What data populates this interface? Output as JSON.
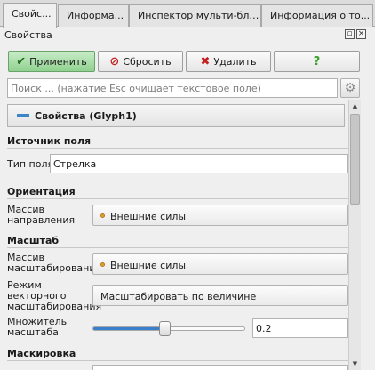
{
  "tabs": [
    {
      "label": "Свойс...",
      "active": true
    },
    {
      "label": "Информа..."
    },
    {
      "label": "Инспектор мульти-бло..."
    },
    {
      "label": "Информация о то..."
    }
  ],
  "panel": {
    "title": "Свойства",
    "float_icon": "float-icon",
    "close_icon": "close-icon"
  },
  "actions": {
    "apply": "Применить",
    "reset": "Сбросить",
    "delete": "Удалить",
    "help": "?"
  },
  "search": {
    "placeholder": "Поиск ... (нажатие Esc очищает текстовое поле)"
  },
  "group": {
    "title": "Свойства (Glyph1)"
  },
  "sections": {
    "field_source": {
      "title": "Источник поля",
      "field_type_label": "Тип поля",
      "field_type_value": "Стрелка"
    },
    "orientation": {
      "title": "Ориентация",
      "label": "Массив направления",
      "value": "Внешние силы"
    },
    "scale": {
      "title": "Масштаб",
      "array_label": "Массив масштабирования",
      "array_value": "Внешние силы",
      "mode_label": "Режим векторного масштабирования",
      "mode_value": "Масштабировать по величине",
      "factor_label": "Множитель масштаба",
      "factor_value": "0.2",
      "factor_fraction": 0.47
    },
    "masking": {
      "title": "Маскировка"
    }
  },
  "colors": {
    "apply_green": "#8fd18f",
    "accent_blue": "#3a7fcc",
    "array_dot": "#e0a030"
  }
}
